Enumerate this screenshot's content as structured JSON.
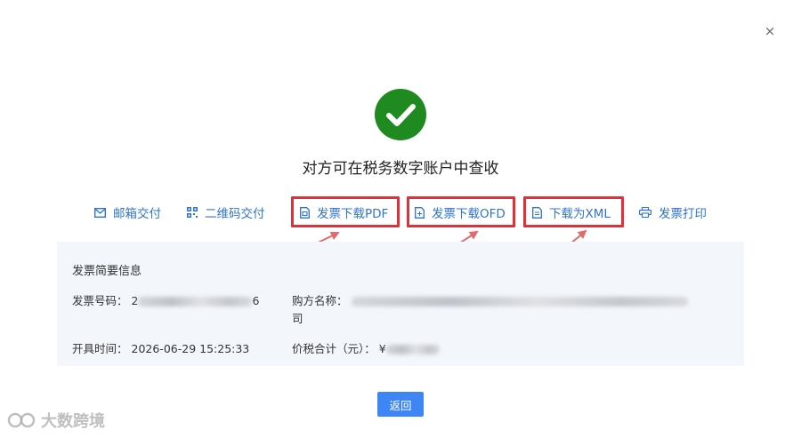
{
  "dialog": {
    "close_label": "×",
    "message": "对方可在税务数字账户中查收"
  },
  "actions": [
    {
      "label": "邮箱交付",
      "icon": "mail-icon"
    },
    {
      "label": "二维码交付",
      "icon": "qr-code-icon"
    },
    {
      "label": "发票下载PDF",
      "icon": "pdf-file-icon",
      "highlighted": true
    },
    {
      "label": "发票下载OFD",
      "icon": "ofd-file-icon",
      "highlighted": true
    },
    {
      "label": "下载为XML",
      "icon": "xml-file-icon",
      "highlighted": true
    },
    {
      "label": "发票打印",
      "icon": "printer-icon"
    }
  ],
  "info": {
    "title": "发票简要信息",
    "invoice_no_label": "发票号码：",
    "invoice_no_prefix": "2",
    "invoice_no_suffix": "6",
    "buyer_label": "购方名称：",
    "buyer_line2": "司",
    "time_label": "开具时间：",
    "time_value": "2026-06-29 15:25:33",
    "total_label": "价税合计（元）：",
    "total_prefix": "¥"
  },
  "buttons": {
    "back_label": "返回"
  },
  "watermark": {
    "text": "大数跨境"
  },
  "colors": {
    "accent": "#2f74d0",
    "success": "#1f8a1f",
    "highlight": "#e0313b",
    "button": "#3e86f5",
    "panel": "#f3f6fb"
  }
}
